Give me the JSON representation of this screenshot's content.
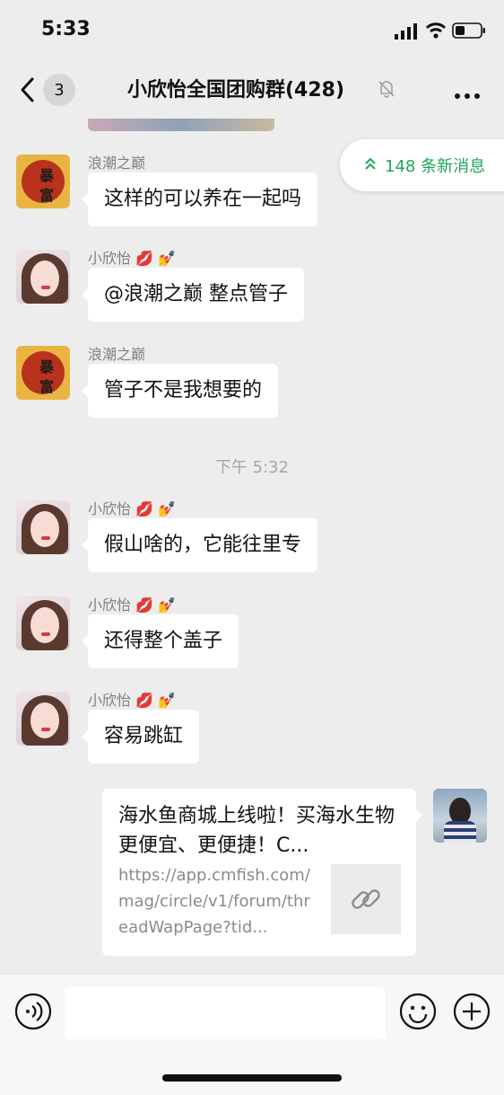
{
  "status_bar": {
    "time": "5:33"
  },
  "nav": {
    "unread_count": "3",
    "title": "小欣怡全国团购群(428)"
  },
  "new_messages": {
    "label": "148 条新消息"
  },
  "messages": [
    {
      "sender": "浪潮之巅",
      "sender_emoji": "",
      "text": "这样的可以养在一起吗",
      "avatar": "baofu-avatar"
    },
    {
      "sender": "小欣怡",
      "sender_emoji": "💋 💅",
      "text": "@浪潮之巅 整点管子",
      "avatar": "xinyi-avatar"
    },
    {
      "sender": "浪潮之巅",
      "sender_emoji": "",
      "text": "管子不是我想要的",
      "avatar": "baofu-avatar"
    },
    {
      "sender": "小欣怡",
      "sender_emoji": "💋 💅",
      "text": "假山啥的，它能往里专",
      "avatar": "xinyi-avatar"
    },
    {
      "sender": "小欣怡",
      "sender_emoji": "💋 💅",
      "text": "还得整个盖子",
      "avatar": "xinyi-avatar"
    },
    {
      "sender": "小欣怡",
      "sender_emoji": "💋 💅",
      "text": "容易跳缸",
      "avatar": "xinyi-avatar"
    }
  ],
  "time_separator": "下午 5:32",
  "avatar_text": {
    "top": "暴",
    "bottom": "富"
  },
  "link_card": {
    "title": "海水鱼商城上线啦！买海水生物更便宜、更便捷！C...",
    "url": "https://app.cmfish.com/mag/circle/v1/forum/threadWapPage?tid..."
  },
  "colors": {
    "accent_green": "#1fa55a",
    "background": "#ededed"
  },
  "icons": [
    "back-arrow-icon",
    "mute-bell-icon",
    "more-icon",
    "double-chevron-up-icon",
    "link-icon",
    "voice-icon",
    "emoji-icon",
    "plus-icon"
  ]
}
